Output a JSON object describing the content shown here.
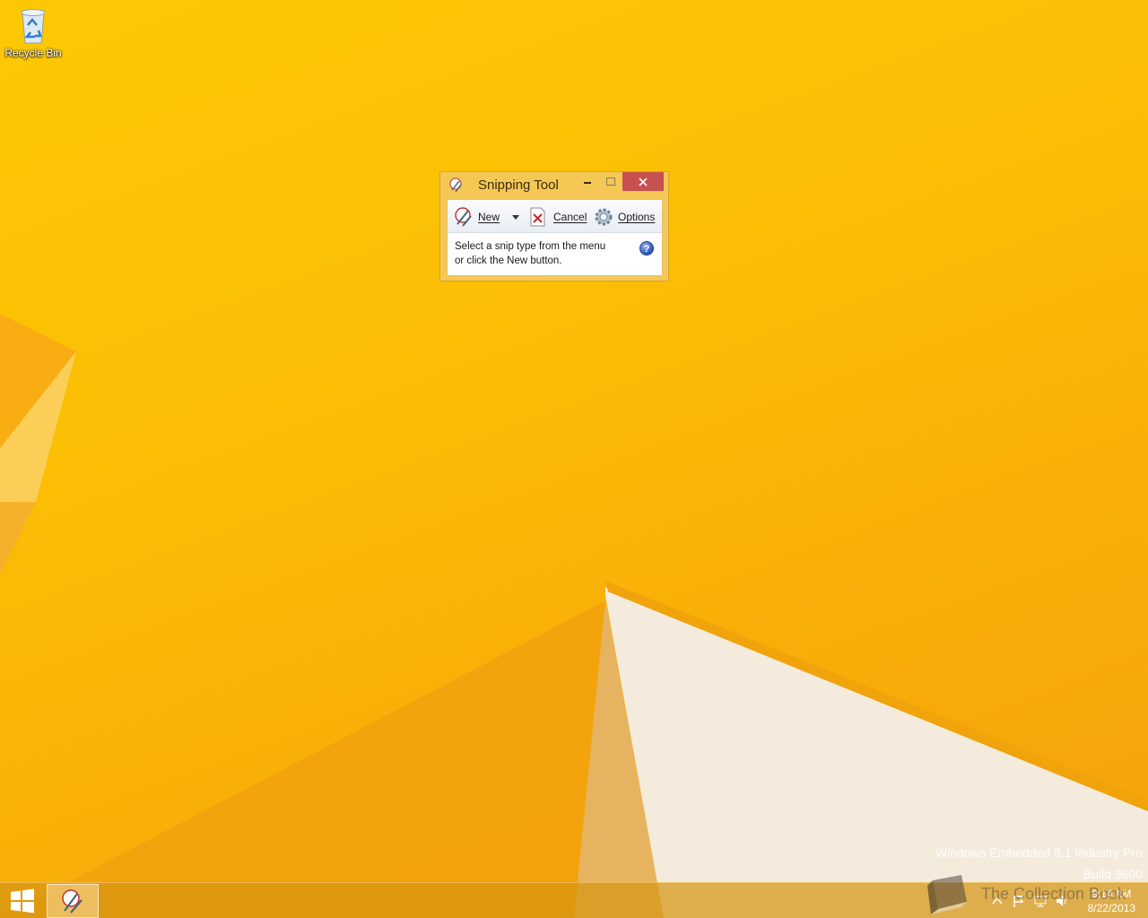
{
  "desktop": {
    "icons": [
      {
        "label": "Recycle Bin",
        "icon": "recycle-bin-icon"
      }
    ]
  },
  "snipping_tool": {
    "title": "Snipping Tool",
    "toolbar": {
      "new_label": "New",
      "cancel_label": "Cancel",
      "options_label": "Options"
    },
    "message_line1": "Select a snip type from the menu",
    "message_line2": "or click the New button.",
    "help_glyph": "?"
  },
  "watermark": {
    "edition": "Windows Embedded 8.1 Industry Pro",
    "build": "Build 9600",
    "overlay_text": "The Collection Book"
  },
  "taskbar": {
    "clock_time": "9:14 AM",
    "clock_date": "8/22/2013",
    "pinned": [
      "snipping-tool-icon"
    ]
  },
  "colors": {
    "wallpaper_accent": "#fbbf05",
    "window_frame": "#f5c855",
    "close_button": "#c75050"
  }
}
